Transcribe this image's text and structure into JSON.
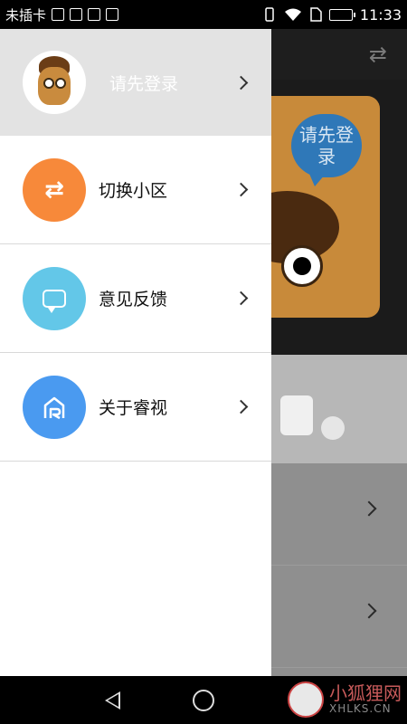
{
  "status_bar": {
    "carrier": "未插卡",
    "time": "11:33"
  },
  "background_app": {
    "banner_bubble_text": "请先登录"
  },
  "drawer": {
    "header": {
      "login_label": "请先登录"
    },
    "items": [
      {
        "label": "切换小区",
        "icon": "swap-icon",
        "color": "#F7893A"
      },
      {
        "label": "意见反馈",
        "icon": "chat-bubble-icon",
        "color": "#63C7E8"
      },
      {
        "label": "关于睿视",
        "icon": "ruishi-logo-icon",
        "color": "#4A9AF0"
      }
    ]
  },
  "watermark": {
    "cn": "小狐狸网",
    "en": "XHLKS.CN"
  },
  "colors": {
    "drawer_header_bg": "#E3E3E3",
    "scrim": "#8D8D8D"
  }
}
